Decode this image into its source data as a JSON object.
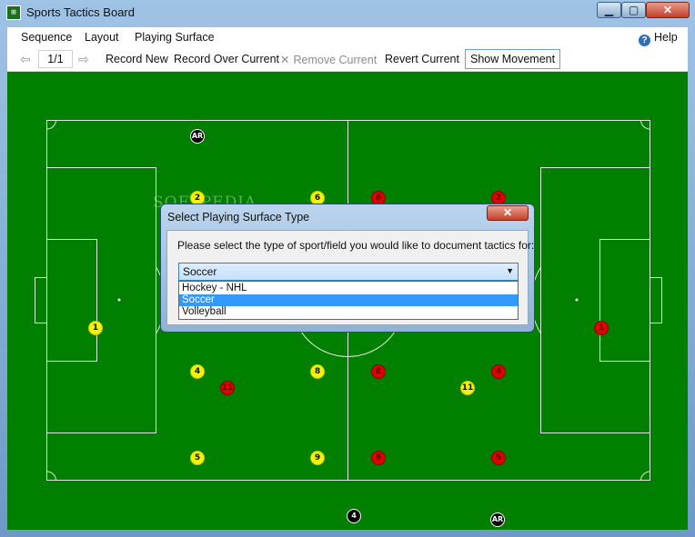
{
  "window": {
    "title": "Sports Tactics Board",
    "icon": "field-icon",
    "controls": [
      "minimize",
      "maximize",
      "close"
    ]
  },
  "menu": {
    "items": [
      "Sequence",
      "Layout",
      "Playing Surface"
    ],
    "help": "Help"
  },
  "toolbar": {
    "page": "1/1",
    "record_new": "Record New",
    "record_over": "Record Over Current",
    "remove_current": "Remove Current",
    "revert_current": "Revert Current",
    "show_movement": "Show Movement"
  },
  "field": {
    "watermark": "SOFTPEDIA",
    "colors": {
      "grass": "#017f01",
      "line": "#ffffff",
      "yellow_team": "#f4f400",
      "red_team": "#e00000",
      "officials": "#000000"
    },
    "players": [
      {
        "label": "AR",
        "team": "black"
      },
      {
        "label": "2",
        "team": "yellow"
      },
      {
        "label": "6",
        "team": "yellow"
      },
      {
        "label": "6",
        "team": "red"
      },
      {
        "label": "2",
        "team": "red"
      },
      {
        "label": "1",
        "team": "yellow"
      },
      {
        "label": "1",
        "team": "red"
      },
      {
        "label": "4",
        "team": "yellow"
      },
      {
        "label": "8",
        "team": "yellow"
      },
      {
        "label": "8",
        "team": "red"
      },
      {
        "label": "4",
        "team": "red"
      },
      {
        "label": "11",
        "team": "red"
      },
      {
        "label": "11",
        "team": "yellow"
      },
      {
        "label": "5",
        "team": "yellow"
      },
      {
        "label": "9",
        "team": "yellow"
      },
      {
        "label": "9",
        "team": "red"
      },
      {
        "label": "5",
        "team": "red"
      },
      {
        "label": "4",
        "team": "black"
      },
      {
        "label": "AR",
        "team": "black"
      }
    ]
  },
  "dialog": {
    "title": "Select Playing Surface Type",
    "prompt": "Please select the type of sport/field you would like to document tactics for:",
    "selected": "Soccer",
    "options": [
      "Hockey - NHL",
      "Soccer",
      "Volleyball"
    ]
  }
}
